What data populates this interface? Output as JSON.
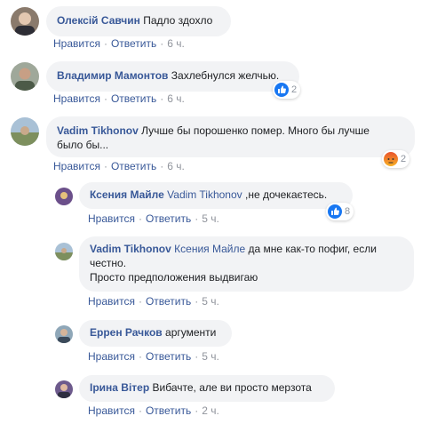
{
  "colors": {
    "link": "#385898",
    "bubble": "#f2f3f5",
    "meta": "#90949c",
    "like": "#1877f2",
    "angry": "#f7714b"
  },
  "comments": [
    {
      "author": "Олексій Савчин",
      "mention": "",
      "text_lines": [
        "Падло здохло"
      ],
      "like": "Нравится",
      "reply": "Ответить",
      "time": "6 ч.",
      "reaction_count": "",
      "reaction_icon": ""
    },
    {
      "author": "Владимир Мамонтов",
      "mention": "",
      "text_lines": [
        "Захлебнулся желчью."
      ],
      "like": "Нравится",
      "reply": "Ответить",
      "time": "6 ч.",
      "reaction_count": "2",
      "reaction_icon": "like-icon"
    },
    {
      "author": "Vadim Tikhonov",
      "mention": "",
      "text_lines": [
        "Лучше бы порошенко помер. Много бы лучше",
        "было бы..."
      ],
      "like": "Нравится",
      "reply": "Ответить",
      "time": "6 ч.",
      "reaction_count": "2",
      "reaction_icon": "angry-icon"
    },
    {
      "author": "Ксения Майле",
      "mention": "Vadim Tikhonov",
      "text_lines": [
        ",не дочекаєтесь."
      ],
      "like": "Нравится",
      "reply": "Ответить",
      "time": "5 ч.",
      "reaction_count": "8",
      "reaction_icon": "like-icon"
    },
    {
      "author": "Vadim Tikhonov",
      "mention": "Ксения Майле",
      "text_lines": [
        "да мне как-то пофиг, если",
        "честно.",
        "Просто предположения выдвигаю"
      ],
      "like": "Нравится",
      "reply": "Ответить",
      "time": "5 ч.",
      "reaction_count": "",
      "reaction_icon": ""
    },
    {
      "author": "Еррен Рачков",
      "mention": "",
      "text_lines": [
        "аргументи"
      ],
      "like": "Нравится",
      "reply": "Ответить",
      "time": "5 ч.",
      "reaction_count": "",
      "reaction_icon": ""
    },
    {
      "author": "Ірина Вітер",
      "mention": "",
      "text_lines": [
        "Вибачте, але ви просто мерзота"
      ],
      "like": "Нравится",
      "reply": "Ответить",
      "time": "2 ч.",
      "reaction_count": "",
      "reaction_icon": ""
    }
  ]
}
